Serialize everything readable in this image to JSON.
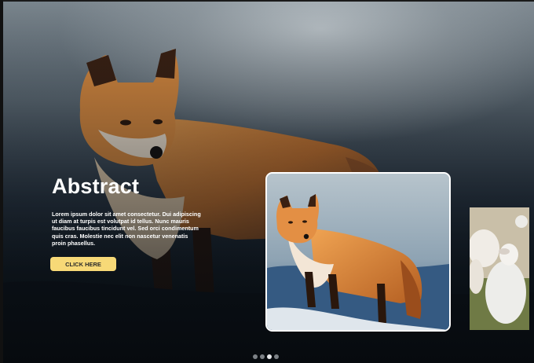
{
  "hero": {
    "title": "Abstract",
    "description": "Lorem ipsum dolor sit amet consectetur. Dui adipiscing ut diam at turpis est volutpat id tellus. Nunc mauris faucibus faucibus tincidunt vel. Sed orci condimentum quis cras. Molestie nec elit non nascetur venenatis proin phasellus.",
    "cta_label": "CLICK HERE"
  },
  "slides": [
    {
      "subject": "fox",
      "state": "active"
    },
    {
      "subject": "sheep",
      "state": "next"
    }
  ],
  "pagination": {
    "count": 4,
    "active_index": 2
  },
  "colors": {
    "cta": "#f7d977",
    "active_dot": "#e8eaec",
    "inactive_dot": "#7c8186"
  }
}
